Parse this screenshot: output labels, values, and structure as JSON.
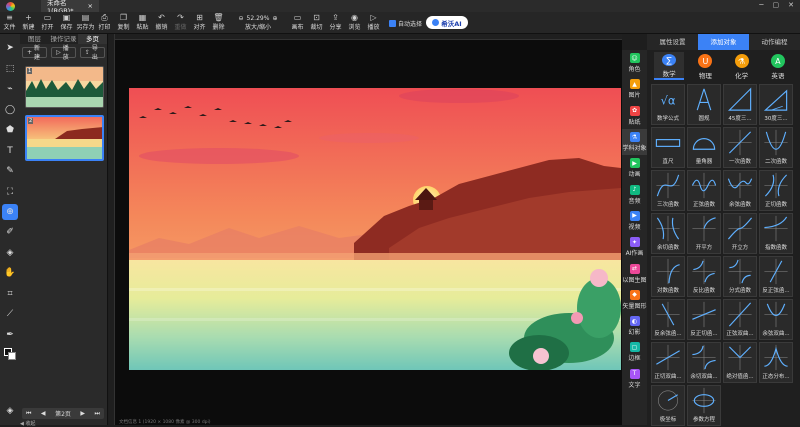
{
  "window": {
    "tab_title": "未命名 1(RGB)*",
    "tab_close": "×"
  },
  "toolbar": {
    "items": [
      {
        "label": "文件",
        "icon": "≡"
      },
      {
        "label": "新建",
        "icon": "+"
      },
      {
        "label": "打开",
        "icon": "▭"
      },
      {
        "label": "保存",
        "icon": "▣"
      },
      {
        "label": "另存为",
        "icon": "▤"
      },
      {
        "label": "打印",
        "icon": "⎙"
      },
      {
        "label": "复制",
        "icon": "❐"
      },
      {
        "label": "粘贴",
        "icon": "▦"
      },
      {
        "label": "撤销",
        "icon": "↶"
      },
      {
        "label": "重做",
        "icon": "↷"
      },
      {
        "label": "对齐",
        "icon": "⊞"
      },
      {
        "label": "删除",
        "icon": "🗑"
      }
    ],
    "zoom_value": "52.29%",
    "zoom_label": "放大/缩小",
    "right_items": [
      {
        "label": "画布",
        "icon": "▭"
      },
      {
        "label": "裁切",
        "icon": "⊡"
      },
      {
        "label": "分享",
        "icon": "⇪"
      },
      {
        "label": "浏览",
        "icon": "◉"
      },
      {
        "label": "播放",
        "icon": "▷"
      }
    ],
    "auto_select_label": "自动选择",
    "ai_label": "希沃AI"
  },
  "left_tools": [
    "➤",
    "⬚",
    "⌁",
    "◯",
    "⬟",
    "T",
    "✎",
    "⛶",
    "⊕",
    "✐",
    "◈",
    "✋",
    "⌗",
    "⟋",
    "✒"
  ],
  "pages_panel": {
    "tabs": [
      "图层",
      "操作记录",
      "多页"
    ],
    "new_label": "新建",
    "play_label": "播放",
    "export_label": "导出",
    "thumbs": [
      "1",
      "2"
    ],
    "footer_label": "第2页",
    "collapse_label": "收起"
  },
  "status": {
    "text": "文档信息 1 (1920 × 1080 像素 @ 300 dpi)"
  },
  "categories": [
    {
      "label": "角色",
      "color": "#22c55e",
      "icon": "☺"
    },
    {
      "label": "图片",
      "color": "#f59e0b",
      "icon": "▲"
    },
    {
      "label": "贴纸",
      "color": "#ef4444",
      "icon": "✿"
    },
    {
      "label": "学科对象",
      "color": "#3b82f6",
      "icon": "⚗"
    },
    {
      "label": "动画",
      "color": "#22c55e",
      "icon": "▶"
    },
    {
      "label": "音频",
      "color": "#10b981",
      "icon": "♪"
    },
    {
      "label": "视频",
      "color": "#3b82f6",
      "icon": "▶"
    },
    {
      "label": "AI作画",
      "color": "#8b5cf6",
      "icon": "✦"
    },
    {
      "label": "以图生图",
      "color": "#ec4899",
      "icon": "⇄"
    },
    {
      "label": "矢量图形",
      "color": "#f97316",
      "icon": "◆"
    },
    {
      "label": "幻影",
      "color": "#6366f1",
      "icon": "◐"
    },
    {
      "label": "边框",
      "color": "#14b8a6",
      "icon": "▢"
    },
    {
      "label": "文字",
      "color": "#a855f7",
      "icon": "T"
    }
  ],
  "right_panel": {
    "tabs": [
      "属性设置",
      "添加对象",
      "动作编程"
    ],
    "subjects": [
      {
        "label": "数学",
        "color": "#3b82f6",
        "icon": "∑"
      },
      {
        "label": "物理",
        "color": "#f97316",
        "icon": "U"
      },
      {
        "label": "化学",
        "color": "#f59e0b",
        "icon": "⚗"
      },
      {
        "label": "英语",
        "color": "#22c55e",
        "icon": "A"
      }
    ],
    "items": [
      {
        "label": "数学公式",
        "kind": "formula"
      },
      {
        "label": "圆规",
        "kind": "compass"
      },
      {
        "label": "45度三...",
        "kind": "tri45"
      },
      {
        "label": "30度三...",
        "kind": "tri30"
      },
      {
        "label": "直尺",
        "kind": "ruler"
      },
      {
        "label": "量角器",
        "kind": "protractor"
      },
      {
        "label": "一次函数",
        "kind": "linear"
      },
      {
        "label": "二次函数",
        "kind": "quad"
      },
      {
        "label": "三次函数",
        "kind": "cubic"
      },
      {
        "label": "正弦函数",
        "kind": "sin"
      },
      {
        "label": "余弦函数",
        "kind": "cos"
      },
      {
        "label": "正切函数",
        "kind": "tan"
      },
      {
        "label": "余切函数",
        "kind": "cot"
      },
      {
        "label": "开平方",
        "kind": "sqrt"
      },
      {
        "label": "开立方",
        "kind": "cbrt"
      },
      {
        "label": "指数函数",
        "kind": "exp"
      },
      {
        "label": "对数函数",
        "kind": "log"
      },
      {
        "label": "反比函数",
        "kind": "inv"
      },
      {
        "label": "分式函数",
        "kind": "frac"
      },
      {
        "label": "反正弦函...",
        "kind": "asin"
      },
      {
        "label": "反余弦函...",
        "kind": "acos"
      },
      {
        "label": "反正切函...",
        "kind": "atan"
      },
      {
        "label": "正弦双曲...",
        "kind": "sinh"
      },
      {
        "label": "余弦双曲...",
        "kind": "cosh"
      },
      {
        "label": "正切双曲...",
        "kind": "tanh"
      },
      {
        "label": "余切双曲...",
        "kind": "coth"
      },
      {
        "label": "绝对值函...",
        "kind": "abs"
      },
      {
        "label": "正态分布...",
        "kind": "normal"
      },
      {
        "label": "极坐标",
        "kind": "polar"
      },
      {
        "label": "参数方程",
        "kind": "param"
      }
    ]
  }
}
